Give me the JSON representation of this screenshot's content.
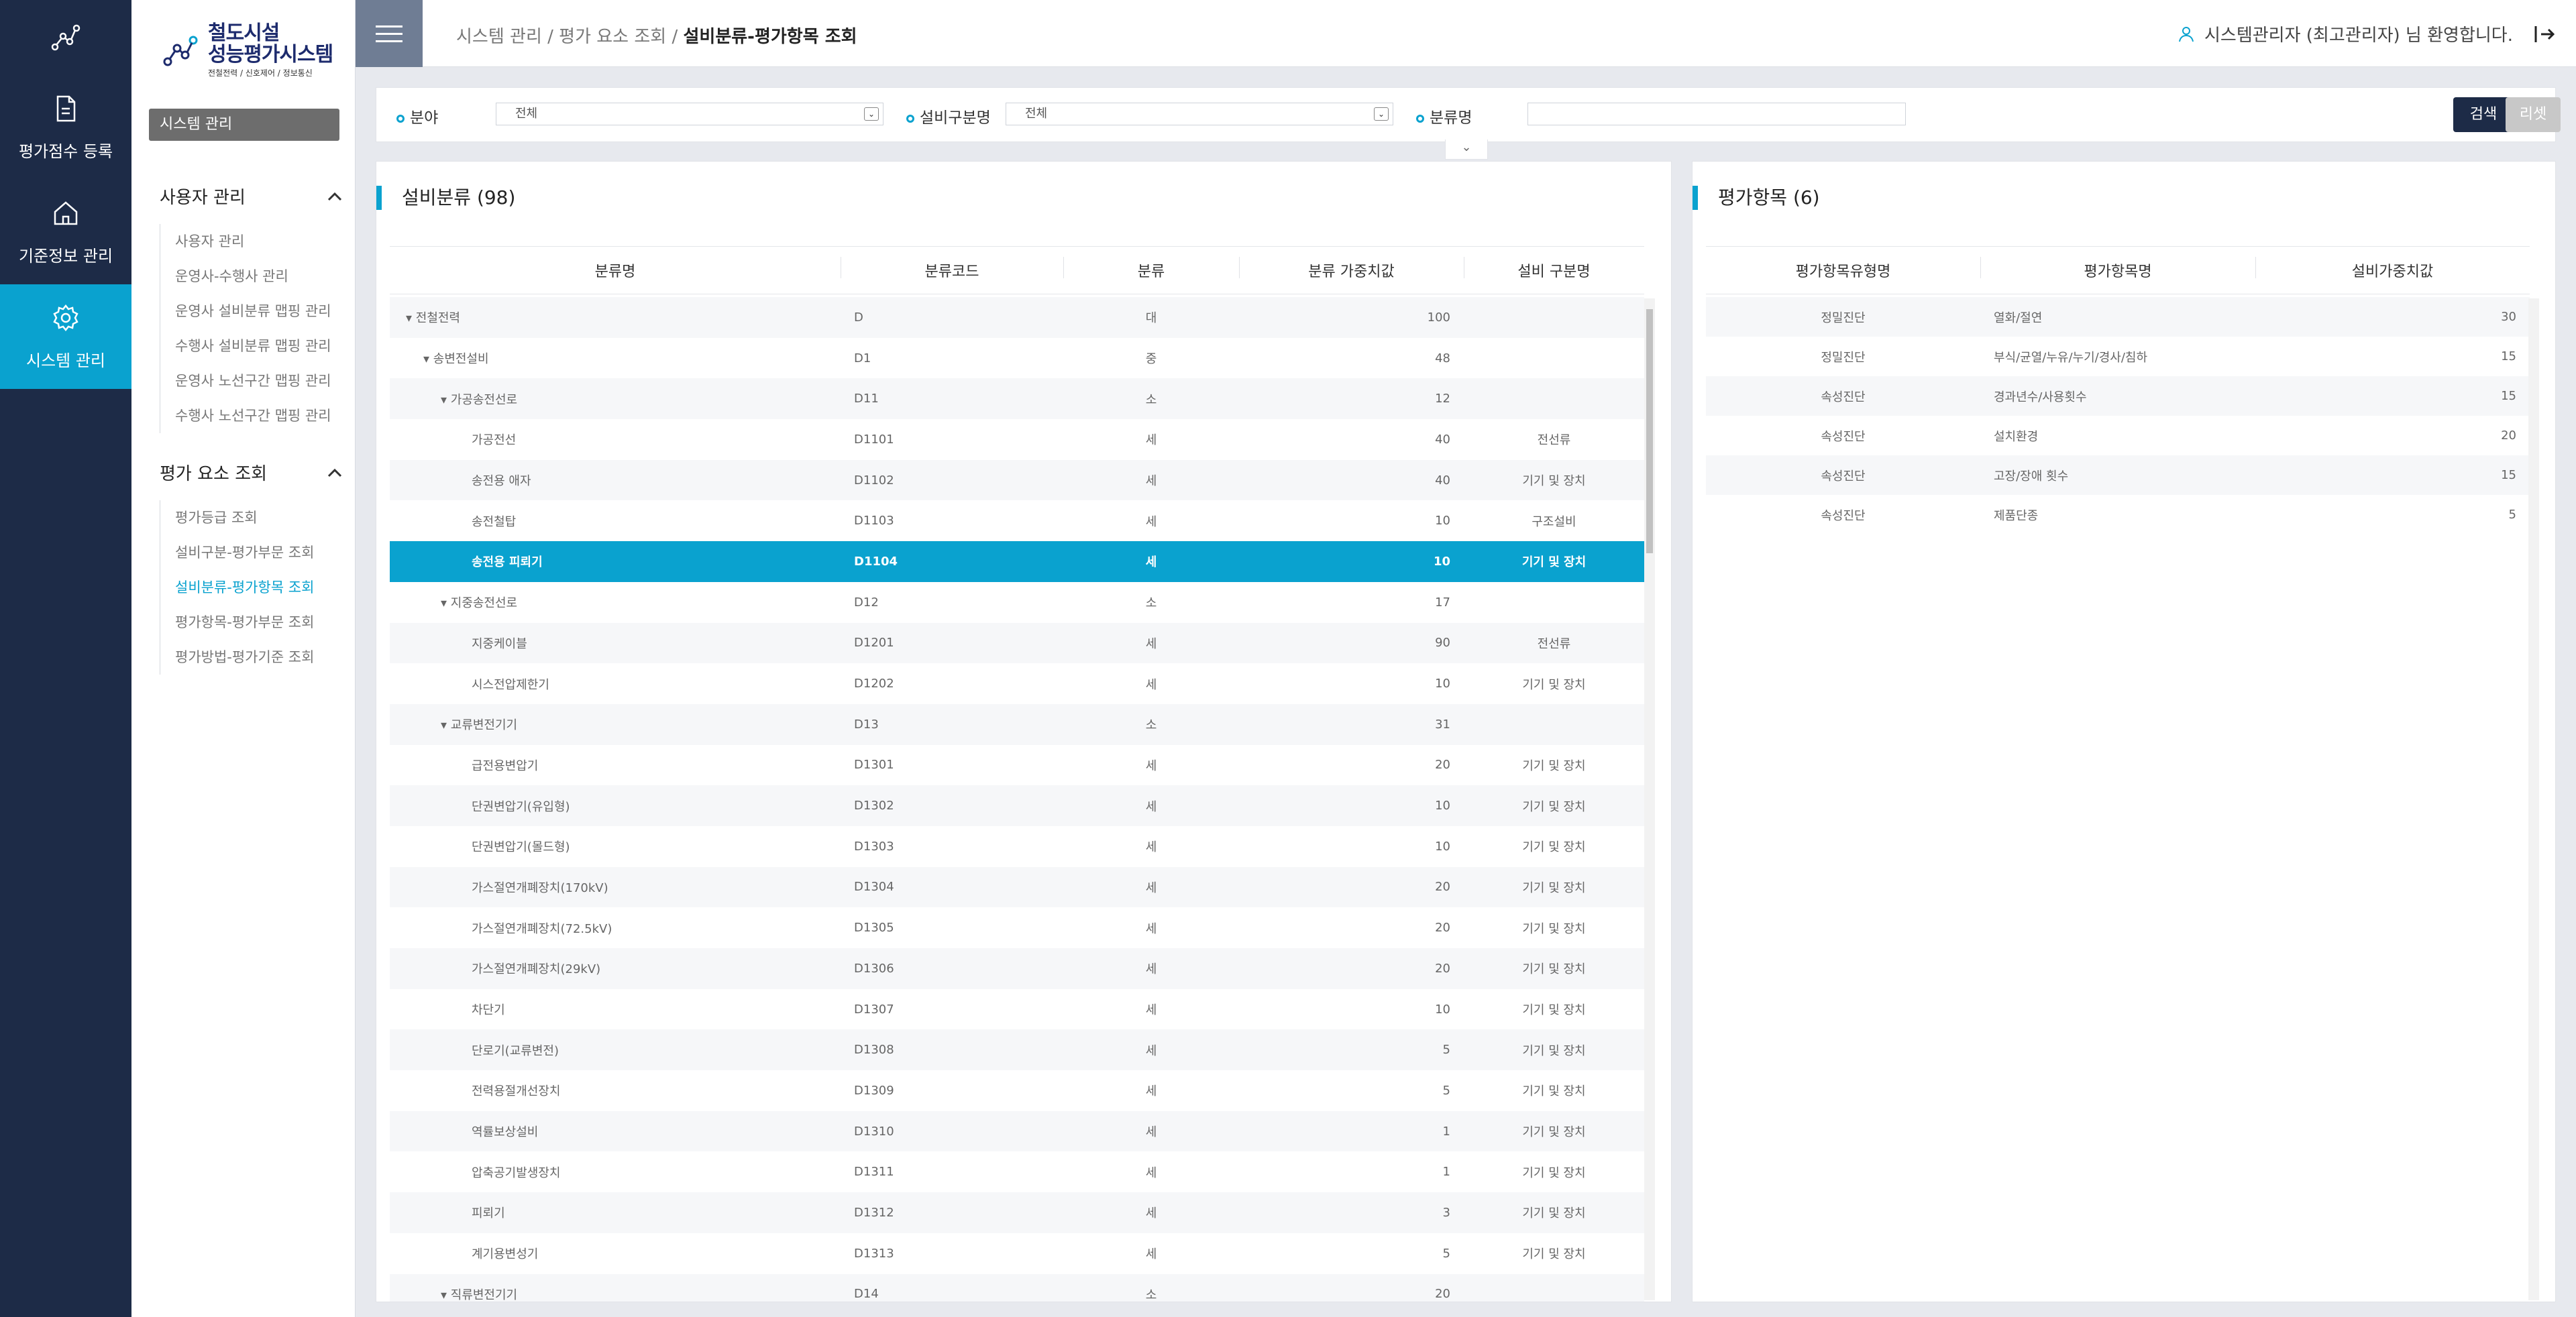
{
  "rail": {
    "items": [
      {
        "label": "평가점수 등록",
        "icon": "document-icon",
        "active": false
      },
      {
        "label": "기준정보 관리",
        "icon": "home-icon",
        "active": false
      },
      {
        "label": "시스템 관리",
        "icon": "gear-icon",
        "active": true
      }
    ]
  },
  "brand": {
    "line1": "철도시설",
    "line2": "성능평가시스템",
    "sub": "전철전력 / 신호제어 / 정보통신"
  },
  "sidebar": {
    "section_title": "시스템 관리",
    "groups": [
      {
        "title": "사용자 관리",
        "items": [
          "사용자 관리",
          "운영사-수행사 관리",
          "운영사 설비분류 맵핑 관리",
          "수행사 설비분류 맵핑 관리",
          "운영사 노선구간 맵핑 관리",
          "수행사 노선구간 맵핑 관리"
        ]
      },
      {
        "title": "평가 요소 조회",
        "items": [
          "평가등급 조회",
          "설비구분-평가부문 조회",
          "설비분류-평가항목 조회",
          "평가항목-평가부문 조회",
          "평가방법-평가기준 조회"
        ],
        "active_index": 2
      }
    ]
  },
  "topbar": {
    "crumb_path": "시스템 관리 / 평가 요소 조회 / ",
    "crumb_current": "설비분류-평가항목 조회",
    "welcome": "시스템관리자 (최고관리자) 님 환영합니다."
  },
  "filter": {
    "field_label": "분야",
    "field_value": "전체",
    "equip_label": "설비구분명",
    "equip_value": "전체",
    "class_label": "분류명",
    "class_value": "",
    "search_label": "검색",
    "reset_label": "리셋"
  },
  "left_panel": {
    "title": "설비분류 (98)",
    "columns": [
      "분류명",
      "분류코드",
      "분류",
      "분류 가중치값",
      "설비 구분명"
    ],
    "rows": [
      {
        "name": "▾ 전철전력",
        "indent": 0,
        "code": "D",
        "level": "대",
        "weight": "100",
        "equip": ""
      },
      {
        "name": "▾ 송변전설비",
        "indent": 1,
        "code": "D1",
        "level": "중",
        "weight": "48",
        "equip": ""
      },
      {
        "name": "▾ 가공송전선로",
        "indent": 2,
        "code": "D11",
        "level": "소",
        "weight": "12",
        "equip": ""
      },
      {
        "name": "가공전선",
        "indent": 3,
        "code": "D1101",
        "level": "세",
        "weight": "40",
        "equip": "전선류"
      },
      {
        "name": "송전용 애자",
        "indent": 3,
        "code": "D1102",
        "level": "세",
        "weight": "40",
        "equip": "기기 및 장치"
      },
      {
        "name": "송전철탑",
        "indent": 3,
        "code": "D1103",
        "level": "세",
        "weight": "10",
        "equip": "구조설비"
      },
      {
        "name": "송전용 피뢰기",
        "indent": 3,
        "code": "D1104",
        "level": "세",
        "weight": "10",
        "equip": "기기 및 장치",
        "selected": true
      },
      {
        "name": "▾ 지중송전선로",
        "indent": 2,
        "code": "D12",
        "level": "소",
        "weight": "17",
        "equip": ""
      },
      {
        "name": "지중케이블",
        "indent": 3,
        "code": "D1201",
        "level": "세",
        "weight": "90",
        "equip": "전선류"
      },
      {
        "name": "시스전압제한기",
        "indent": 3,
        "code": "D1202",
        "level": "세",
        "weight": "10",
        "equip": "기기 및 장치"
      },
      {
        "name": "▾ 교류변전기기",
        "indent": 2,
        "code": "D13",
        "level": "소",
        "weight": "31",
        "equip": ""
      },
      {
        "name": "급전용변압기",
        "indent": 3,
        "code": "D1301",
        "level": "세",
        "weight": "20",
        "equip": "기기 및 장치"
      },
      {
        "name": "단권변압기(유입형)",
        "indent": 3,
        "code": "D1302",
        "level": "세",
        "weight": "10",
        "equip": "기기 및 장치"
      },
      {
        "name": "단권변압기(몰드형)",
        "indent": 3,
        "code": "D1303",
        "level": "세",
        "weight": "10",
        "equip": "기기 및 장치"
      },
      {
        "name": "가스절연개폐장치(170kV)",
        "indent": 3,
        "code": "D1304",
        "level": "세",
        "weight": "20",
        "equip": "기기 및 장치"
      },
      {
        "name": "가스절연개폐장치(72.5kV)",
        "indent": 3,
        "code": "D1305",
        "level": "세",
        "weight": "20",
        "equip": "기기 및 장치"
      },
      {
        "name": "가스절연개폐장치(29kV)",
        "indent": 3,
        "code": "D1306",
        "level": "세",
        "weight": "20",
        "equip": "기기 및 장치"
      },
      {
        "name": "차단기",
        "indent": 3,
        "code": "D1307",
        "level": "세",
        "weight": "10",
        "equip": "기기 및 장치"
      },
      {
        "name": "단로기(교류변전)",
        "indent": 3,
        "code": "D1308",
        "level": "세",
        "weight": "5",
        "equip": "기기 및 장치"
      },
      {
        "name": "전력용절개선장치",
        "indent": 3,
        "code": "D1309",
        "level": "세",
        "weight": "5",
        "equip": "기기 및 장치"
      },
      {
        "name": "역률보상설비",
        "indent": 3,
        "code": "D1310",
        "level": "세",
        "weight": "1",
        "equip": "기기 및 장치"
      },
      {
        "name": "압축공기발생장치",
        "indent": 3,
        "code": "D1311",
        "level": "세",
        "weight": "1",
        "equip": "기기 및 장치"
      },
      {
        "name": "피뢰기",
        "indent": 3,
        "code": "D1312",
        "level": "세",
        "weight": "3",
        "equip": "기기 및 장치"
      },
      {
        "name": "계기용변성기",
        "indent": 3,
        "code": "D1313",
        "level": "세",
        "weight": "5",
        "equip": "기기 및 장치"
      },
      {
        "name": "▾ 직류변전기기",
        "indent": 2,
        "code": "D14",
        "level": "소",
        "weight": "20",
        "equip": ""
      }
    ]
  },
  "right_panel": {
    "title": "평가항목 (6)",
    "columns": [
      "평가항목유형명",
      "평가항목명",
      "설비가중치값"
    ],
    "rows": [
      {
        "type": "정밀진단",
        "name": "열화/절연",
        "weight": "30"
      },
      {
        "type": "정밀진단",
        "name": "부식/균열/누유/누기/경사/침하",
        "weight": "15"
      },
      {
        "type": "속성진단",
        "name": "경과년수/사용횟수",
        "weight": "15"
      },
      {
        "type": "속성진단",
        "name": "설치환경",
        "weight": "20"
      },
      {
        "type": "속성진단",
        "name": "고장/장애 횟수",
        "weight": "15"
      },
      {
        "type": "속성진단",
        "name": "제품단종",
        "weight": "5"
      }
    ]
  },
  "colors": {
    "navy": "#1d2b47",
    "accent": "#0aa2cf",
    "brand": "#1d2b6d"
  }
}
